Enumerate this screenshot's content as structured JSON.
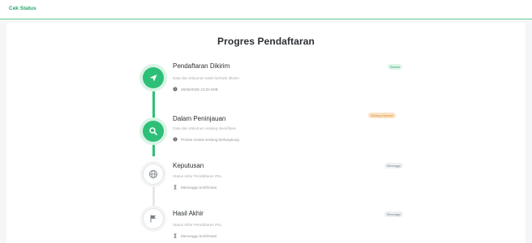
{
  "header": {
    "title": "Cek Status"
  },
  "main": {
    "title": "Progres Pendaftaran",
    "steps": [
      {
        "title": "Pendaftaran Dikirim",
        "description": "Data dan dokumen telah berhasil dikirim",
        "meta": "26/06/2025 21:03 WIB",
        "badge": "Selesai",
        "icon": "send-icon",
        "state": "done"
      },
      {
        "title": "Dalam Peninjauan",
        "description": "Data dan dokumen sedang diverifikasi",
        "meta": "Proses review sedang berlangsung",
        "badge": "Sedang Diproses",
        "icon": "search-icon",
        "state": "done"
      },
      {
        "title": "Keputusan",
        "description": "Status Akhir Pendaftaran PKL",
        "meta": "Menunggu konfirmasi",
        "badge": "Menunggu",
        "icon": "globe-icon",
        "state": "pending"
      },
      {
        "title": "Hasil Akhir",
        "description": "Status Akhir Pendaftaran PKL",
        "meta": "Menunggu konfirmasi",
        "badge": "Menunggu",
        "icon": "flag-icon",
        "state": "pending"
      }
    ]
  },
  "colors": {
    "accent": "#2dbf78",
    "warning": "#d98a2b",
    "muted": "#a7adb2"
  }
}
